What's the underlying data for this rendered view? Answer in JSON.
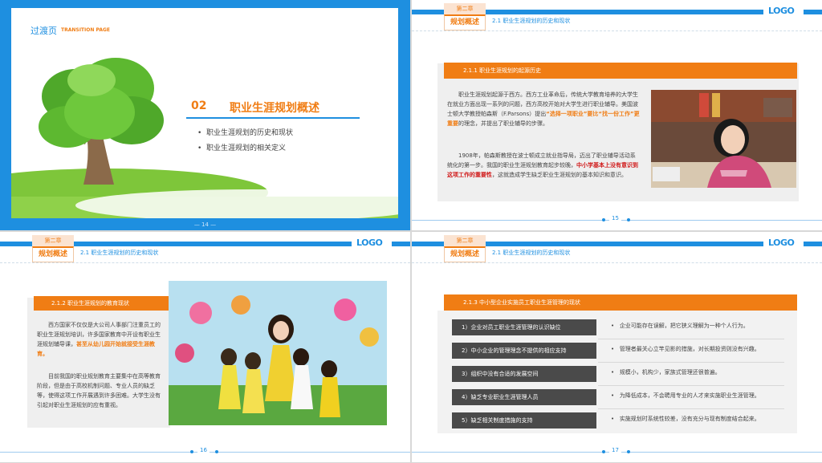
{
  "slide14": {
    "title": "过渡页",
    "subtitle": "TRANSITION PAGE",
    "number": "02",
    "heading": "职业生涯规划概述",
    "bullets": [
      "职业生涯规划的历史和现状",
      "职业生涯规划的相关定义"
    ],
    "page": "— 14 —"
  },
  "header": {
    "chapter": "第二章",
    "badge": "规划概述",
    "logo": "LOGO"
  },
  "slide15": {
    "section": "2.1 职业生涯规划的历史和现状",
    "box_title": "2.1.1 职业生涯规划的起源历史",
    "p1_a": "职业生涯规划起源于西方。西方工业革命后，传统大学教育培养的大学生在就业方面出现一系列的问题，西方高校开始对大学生进行职业辅导。美国波士顿大学教授帕森斯（F.Parsons）提出",
    "p1_hl": "“选择一项职业”要比“找一份工作”更重要",
    "p1_b": "的理念，并提出了职业辅导的步骤。",
    "p2_a": "1908年，帕森斯教授在波士顿成立就业指导局，迈出了职业辅导活动系统化的第一步。我国的职业生涯规划教育起步较晚，",
    "p2_hl": "中小学基本上没有意识到这项工作的重要性",
    "p2_b": "，这就造成学生缺乏职业生涯规划的基本知识和意识。",
    "page": "15"
  },
  "slide16": {
    "section": "2.1 职业生涯规划的历史和现状",
    "box_title": "2.1.2 职业生涯规划的教育现状",
    "p1_a": "西方国家不仅仅是大公司人事部门注重员工的职业生涯规划培训，许多国家教育中开设有职业生涯规划辅导课，",
    "p1_hl": "甚至从幼儿园开始就接受生涯教育。",
    "p2": "目前我国的职业规划教育主要集中在高等教育阶段，但是由于高校机制问题、专业人员的缺乏等，使得这项工作开展遇到许多困难。大学生没有引起对职业生涯规划的应有重视。",
    "page": "16"
  },
  "slide17": {
    "section": "2.1 职业生涯规划的历史和现状",
    "box_title": "2.1.3 中小型企业实施员工职业生涯管理的现状",
    "rows": [
      {
        "left": "1）企业对员工职业生涯管理的认识缺位",
        "right": "企业可能存在误解，把它狭义理解为一种个人行为。"
      },
      {
        "left": "2）中小企业的管理理念不提供的相应支持",
        "right": "管理者最关心立竿见影的措施，对长期投资则没有兴趣。"
      },
      {
        "left": "3）组织中没有合适的发展空间",
        "right": "规模小，机构少，家族式管理还很普遍。"
      },
      {
        "left": "4）缺乏专业职业生涯管理人员",
        "right": "为降低成本，不会聘用专业的人才来实施职业生涯管理。"
      },
      {
        "left": "5）缺乏相关制度措施的支持",
        "right": "实施规划时系统性较差，没有充分与现有制度结合起来。"
      }
    ],
    "page": "17"
  }
}
